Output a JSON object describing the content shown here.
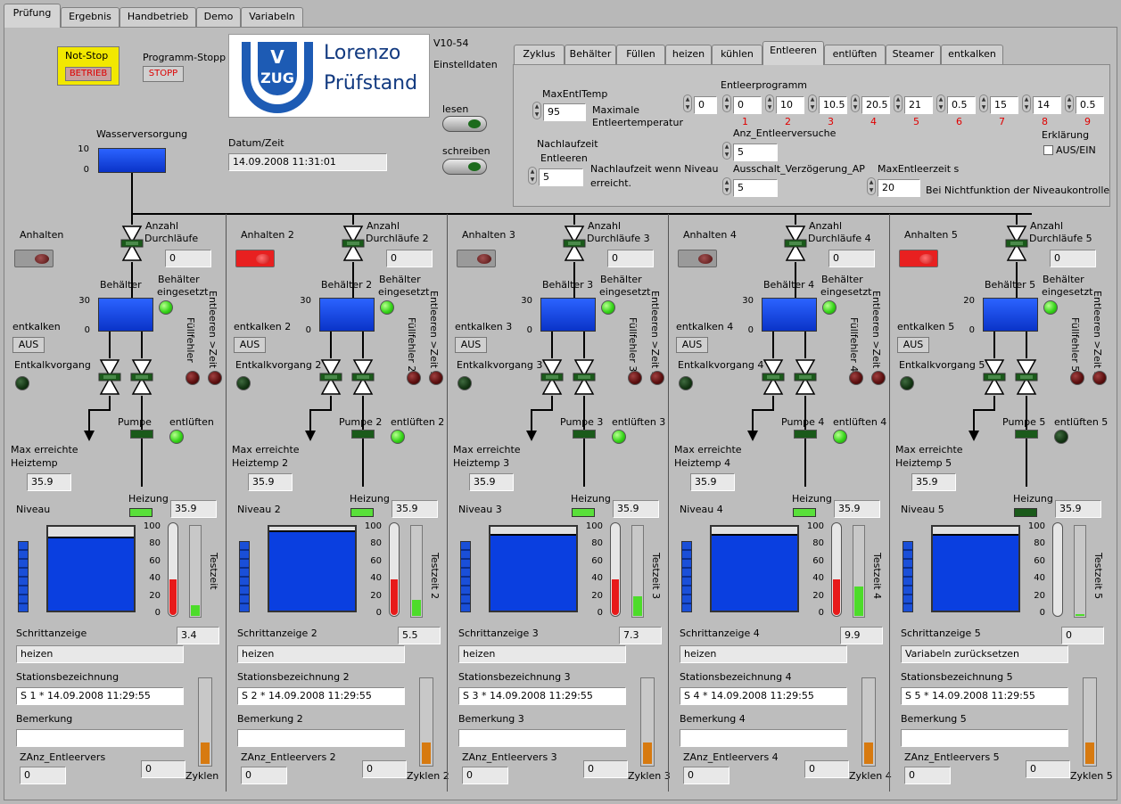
{
  "tabs": [
    "Prüfung",
    "Ergebnis",
    "Handbetrieb",
    "Demo",
    "Variabeln"
  ],
  "subtabs": [
    "Zyklus",
    "Behälter",
    "Füllen",
    "heizen",
    "kühlen",
    "Entleeren",
    "entlüften",
    "Steamer",
    "entkalken"
  ],
  "notstop": {
    "label": "Not-Stop",
    "badge": "BETRIEB"
  },
  "prog": {
    "label": "Programm-Stopp",
    "badge": "STOPP"
  },
  "logo": {
    "line1": "Lorenzo",
    "line2": "Prüfstand",
    "mark_top": "V",
    "mark_bottom": "ZUG"
  },
  "version": "V10-54",
  "einstell": "Einstelldaten",
  "lesen": "lesen",
  "schreiben": "schreiben",
  "datum_label": "Datum/Zeit",
  "datum": "14.09.2008 11:31:01",
  "wasser": {
    "label": "Wasserversorgung",
    "scale_top": "10",
    "scale_bottom": "0"
  },
  "entl": {
    "maxtemp_label": "MaxEntlTemp",
    "maxtemp": "95",
    "maxtemp_desc1": "Maximale",
    "maxtemp_desc2": "Entleertemperatur",
    "nach_label1": "Nachlaufzeit",
    "nach_label2": "Entleeren",
    "nach": "5",
    "nach_desc1": "Nachlaufzeit wenn Niveau",
    "nach_desc2": "erreicht.",
    "prog_label": "Entleerprogramm",
    "prog_index": "0",
    "prog_values": [
      "0",
      "10",
      "10.5",
      "20.5",
      "21",
      "0.5",
      "15",
      "14",
      "0.5"
    ],
    "prog_numbers": [
      "1",
      "2",
      "3",
      "4",
      "5",
      "6",
      "7",
      "8",
      "9"
    ],
    "anz_label": "Anz_Entleerversuche",
    "anz": "5",
    "aus_label": "Ausschalt_Verzögerung_AP",
    "aus": "5",
    "maxzeit_label": "MaxEntleerzeit s",
    "maxzeit": "20",
    "maxzeit_desc": "Bei Nichtfunktion der Niveaukontrolle",
    "erkl": "Erklärung",
    "erkl_check": "AUS/EIN"
  },
  "colors": {
    "red_number": "#e00000",
    "tank_blue": "#0a3fe0",
    "led_green": "#37d61a",
    "thermo_red": "#e81a1a",
    "cycle_orange": "#d77a10"
  },
  "stations": [
    {
      "anhalten": "Anhalten",
      "anhalten_on": false,
      "anzahl1": "Anzahl",
      "anzahl2": "Durchläufe",
      "durch": "0",
      "behaelter": "Behälter",
      "scale_top": "30",
      "scale_bottom": "0",
      "eingesetzt1": "Behälter",
      "eingesetzt2": "eingesetzt",
      "entkalken": "entkalken",
      "aus": "AUS",
      "entkalkvorgang": "Entkalkvorgang",
      "fuell": "Füllfehler",
      "entleeren": "Entleeren >Zeit",
      "pumpe": "Pumpe",
      "entlueften": "entlüften",
      "entl_led_on": true,
      "maxh1": "Max erreichte",
      "maxh2": "Heiztemp",
      "maxh": "35.9",
      "heizung": "Heizung",
      "heiz_on": true,
      "heizval": "35.9",
      "niveau": "Niveau",
      "niveau_level": 0.88,
      "thermo_level": 0.38,
      "testzeit": "Testzeit",
      "testzeit_level": 0.12,
      "schritt_label": "Schrittanzeige",
      "schritt": "3.4",
      "step": "heizen",
      "stat_label": "Stationsbezeichnung",
      "stat": "S 1 * 14.09.2008 11:29:55",
      "bem_label": "Bemerkung",
      "zanz_label": "ZAnz_Entleervers",
      "zanz": "0",
      "zyk": "0",
      "zyklen": "Zyklen",
      "cyc_level": 0.25
    },
    {
      "anhalten": "Anhalten 2",
      "anhalten_on": true,
      "anzahl1": "Anzahl",
      "anzahl2": "Durchläufe 2",
      "durch": "0",
      "behaelter": "Behälter 2",
      "scale_top": "30",
      "scale_bottom": "0",
      "eingesetzt1": "Behälter",
      "eingesetzt2": "eingesetzt",
      "entkalken": "entkalken 2",
      "aus": "AUS",
      "entkalkvorgang": "Entkalkvorgang 2",
      "fuell": "Füllfehler 2",
      "entleeren": "Entleeren >Zeit 2",
      "pumpe": "Pumpe 2",
      "entlueften": "entlüften 2",
      "entl_led_on": true,
      "maxh1": "Max erreichte",
      "maxh2": "Heiztemp 2",
      "maxh": "35.9",
      "heizung": "Heizung",
      "heiz_on": true,
      "heizval": "35.9",
      "niveau": "Niveau 2",
      "niveau_level": 0.96,
      "thermo_level": 0.38,
      "testzeit": "Testzeit 2",
      "testzeit_level": 0.18,
      "schritt_label": "Schrittanzeige 2",
      "schritt": "5.5",
      "step": "heizen",
      "stat_label": "Stationsbezeichnung 2",
      "stat": "S 2 * 14.09.2008 11:29:55",
      "bem_label": "Bemerkung 2",
      "zanz_label": "ZAnz_Entleervers 2",
      "zanz": "0",
      "zyk": "0",
      "zyklen": "Zyklen 2",
      "cyc_level": 0.25
    },
    {
      "anhalten": "Anhalten 3",
      "anhalten_on": false,
      "anzahl1": "Anzahl",
      "anzahl2": "Durchläufe 3",
      "durch": "0",
      "behaelter": "Behälter 3",
      "scale_top": "30",
      "scale_bottom": "0",
      "eingesetzt1": "Behälter",
      "eingesetzt2": "eingesetzt",
      "entkalken": "entkalken 3",
      "aus": "AUS",
      "entkalkvorgang": "Entkalkvorgang 3",
      "fuell": "Füllfehler 3",
      "entleeren": "Entleeren >Zeit 3",
      "pumpe": "Pumpe 3",
      "entlueften": "entlüften 3",
      "entl_led_on": true,
      "maxh1": "Max erreichte",
      "maxh2": "Heiztemp 3",
      "maxh": "35.9",
      "heizung": "Heizung",
      "heiz_on": true,
      "heizval": "35.9",
      "niveau": "Niveau 3",
      "niveau_level": 0.92,
      "thermo_level": 0.38,
      "testzeit": "Testzeit 3",
      "testzeit_level": 0.22,
      "schritt_label": "Schrittanzeige 3",
      "schritt": "7.3",
      "step": "heizen",
      "stat_label": "Stationsbezeichnung 3",
      "stat": "S 3 * 14.09.2008 11:29:55",
      "bem_label": "Bemerkung 3",
      "zanz_label": "ZAnz_Entleervers 3",
      "zanz": "0",
      "zyk": "0",
      "zyklen": "Zyklen 3",
      "cyc_level": 0.25
    },
    {
      "anhalten": "Anhalten 4",
      "anhalten_on": false,
      "anzahl1": "Anzahl",
      "anzahl2": "Durchläufe 4",
      "durch": "0",
      "behaelter": "Behälter 4",
      "scale_top": "30",
      "scale_bottom": "0",
      "eingesetzt1": "Behälter",
      "eingesetzt2": "eingesetzt",
      "entkalken": "entkalken 4",
      "aus": "AUS",
      "entkalkvorgang": "Entkalkvorgang 4",
      "fuell": "Füllfehler 4",
      "entleeren": "Entleeren >Zeit 4",
      "pumpe": "Pumpe 4",
      "entlueften": "entlüften 4",
      "entl_led_on": true,
      "maxh1": "Max erreichte",
      "maxh2": "Heiztemp 4",
      "maxh": "35.9",
      "heizung": "Heizung",
      "heiz_on": true,
      "heizval": "35.9",
      "niveau": "Niveau 4",
      "niveau_level": 0.92,
      "thermo_level": 0.38,
      "testzeit": "Testzeit 4",
      "testzeit_level": 0.32,
      "schritt_label": "Schrittanzeige 4",
      "schritt": "9.9",
      "step": "heizen",
      "stat_label": "Stationsbezeichnung 4",
      "stat": "S 4 * 14.09.2008 11:29:55",
      "bem_label": "Bemerkung 4",
      "zanz_label": "ZAnz_Entleervers 4",
      "zanz": "0",
      "zyk": "0",
      "zyklen": "Zyklen 4",
      "cyc_level": 0.25
    },
    {
      "anhalten": "Anhalten 5",
      "anhalten_on": true,
      "anzahl1": "Anzahl",
      "anzahl2": "Durchläufe 5",
      "durch": "0",
      "behaelter": "Behälter 5",
      "scale_top": "20",
      "scale_bottom": "0",
      "eingesetzt1": "Behälter",
      "eingesetzt2": "eingesetzt",
      "entkalken": "entkalken 5",
      "aus": "AUS",
      "entkalkvorgang": "Entkalkvorgang 5",
      "fuell": "Füllfehler 5",
      "entleeren": "Entleeren >Zeit 5",
      "pumpe": "Pumpe 5",
      "entlueften": "entlüften 5",
      "entl_led_on": false,
      "maxh1": "Max erreichte",
      "maxh2": "Heiztemp 5",
      "maxh": "35.9",
      "heizung": "Heizung",
      "heiz_on": false,
      "heizval": "35.9",
      "niveau": "Niveau 5",
      "niveau_level": 0.92,
      "thermo_level": 0,
      "testzeit": "Testzeit 5",
      "testzeit_level": 0.02,
      "schritt_label": "Schrittanzeige 5",
      "schritt": "0",
      "step": "Variabeln zurücksetzen",
      "stat_label": "Stationsbezeichnung 5",
      "stat": "S 5 * 14.09.2008 11:29:55",
      "bem_label": "Bemerkung 5",
      "zanz_label": "ZAnz_Entleervers 5",
      "zanz": "0",
      "zyk": "0",
      "zyklen": "Zyklen 5",
      "cyc_level": 0.25
    }
  ],
  "scales": {
    "thermo": [
      "100",
      "80",
      "60",
      "40",
      "20",
      "0"
    ]
  }
}
